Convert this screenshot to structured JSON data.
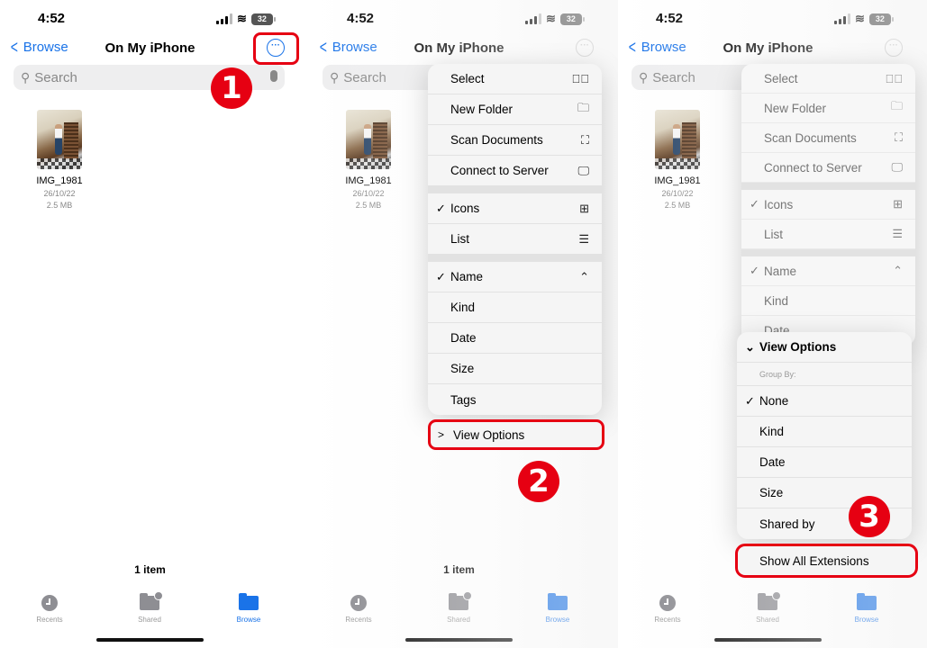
{
  "status": {
    "time": "4:52",
    "battery": "32"
  },
  "nav": {
    "back_label": "Browse",
    "title": "On My iPhone"
  },
  "search": {
    "placeholder": "Search"
  },
  "file": {
    "name": "IMG_1981",
    "date": "26/10/22",
    "size": "2.5 MB"
  },
  "item_count": "1 item",
  "tabs": [
    {
      "label": "Recents",
      "icon": "clock-icon"
    },
    {
      "label": "Shared",
      "icon": "shared-folder-icon"
    },
    {
      "label": "Browse",
      "icon": "folder-icon",
      "active": true
    }
  ],
  "menu": {
    "actions": [
      {
        "label": "Select",
        "icon": "checkmark-circle-icon",
        "glyph": "⊘"
      },
      {
        "label": "New Folder",
        "icon": "new-folder-icon",
        "glyph": "🗀"
      },
      {
        "label": "Scan Documents",
        "icon": "scan-document-icon",
        "glyph": "⌗"
      },
      {
        "label": "Connect to Server",
        "icon": "monitor-icon",
        "glyph": "🖵"
      }
    ],
    "view_modes": [
      {
        "label": "Icons",
        "checked": true,
        "icon": "grid-icon",
        "glyph": "▦"
      },
      {
        "label": "List",
        "checked": false,
        "icon": "list-icon",
        "glyph": "☰"
      }
    ],
    "sort": [
      {
        "label": "Name",
        "checked": true,
        "glyph": "⌃"
      },
      {
        "label": "Kind"
      },
      {
        "label": "Date"
      },
      {
        "label": "Size"
      },
      {
        "label": "Tags"
      }
    ],
    "view_options_label": "View Options"
  },
  "view_options": {
    "title": "View Options",
    "group_by_label": "Group By:",
    "groups": [
      {
        "label": "None",
        "checked": true
      },
      {
        "label": "Kind"
      },
      {
        "label": "Date"
      },
      {
        "label": "Size"
      },
      {
        "label": "Shared by"
      }
    ],
    "show_extensions_label": "Show All Extensions"
  },
  "steps": [
    "1",
    "2",
    "3"
  ],
  "colors": {
    "accent": "#1a73e8",
    "highlight": "#e60012"
  }
}
